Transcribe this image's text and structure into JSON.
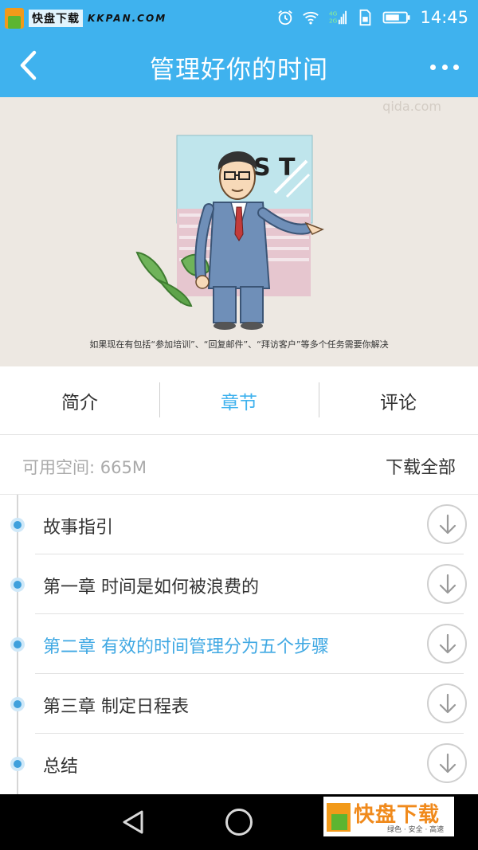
{
  "status_bar": {
    "watermark_text": "快盘下载",
    "watermark_url": "KKPAN.COM",
    "network": "4G 2G",
    "time": "14:45"
  },
  "header": {
    "title": "管理好你的时间",
    "back_icon": "chevron-left-icon",
    "more_icon": "more-dots-icon"
  },
  "banner": {
    "watermark": "qida.com",
    "sign_text": "S T",
    "caption": "如果现在有包括“参加培训”、“回复邮件”、“拜访客户”等多个任务需要你解决"
  },
  "tabs": [
    {
      "label": "简介",
      "active": false
    },
    {
      "label": "章节",
      "active": true
    },
    {
      "label": "评论",
      "active": false
    }
  ],
  "storage": {
    "available_label": "可用空间: 665M",
    "download_all_label": "下载全部"
  },
  "chapters": [
    {
      "title": "故事指引",
      "active": false
    },
    {
      "title": "第一章 时间是如何被浪费的",
      "active": false
    },
    {
      "title": "第二章 有效的时间管理分为五个步骤",
      "active": true
    },
    {
      "title": "第三章 制定日程表",
      "active": false
    },
    {
      "title": "总结",
      "active": false
    }
  ],
  "nav_watermark": {
    "text": "快盘下载",
    "sub": "绿色 · 安全 · 高速"
  },
  "colors": {
    "primary": "#3fb2ee",
    "active_text": "#3fa8e3",
    "timeline_dot": "#3fa0dc"
  }
}
